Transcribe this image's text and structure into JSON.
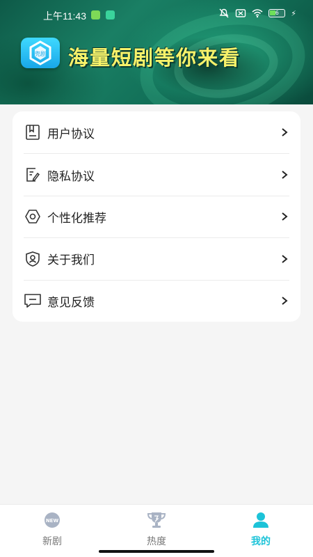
{
  "status_bar": {
    "time": "上午11:43",
    "battery_level": "6"
  },
  "banner": {
    "logo_text": "兜剧",
    "title": "海量短剧等你来看"
  },
  "menu": {
    "items": [
      {
        "label": "用户协议",
        "icon": "agreement-icon"
      },
      {
        "label": "隐私协议",
        "icon": "privacy-doc-icon"
      },
      {
        "label": "个性化推荐",
        "icon": "settings-gear-icon"
      },
      {
        "label": "关于我们",
        "icon": "shield-user-icon"
      },
      {
        "label": "意见反馈",
        "icon": "feedback-message-icon"
      }
    ]
  },
  "tabbar": {
    "tabs": [
      {
        "label": "新剧",
        "icon": "new-badge-icon",
        "active": false
      },
      {
        "label": "热度",
        "icon": "trophy-icon",
        "active": false
      },
      {
        "label": "我的",
        "icon": "user-icon",
        "active": true
      }
    ]
  },
  "colors": {
    "accent": "#1cc3d8",
    "banner_title": "#f7f26a",
    "background": "#f5f5f5"
  }
}
